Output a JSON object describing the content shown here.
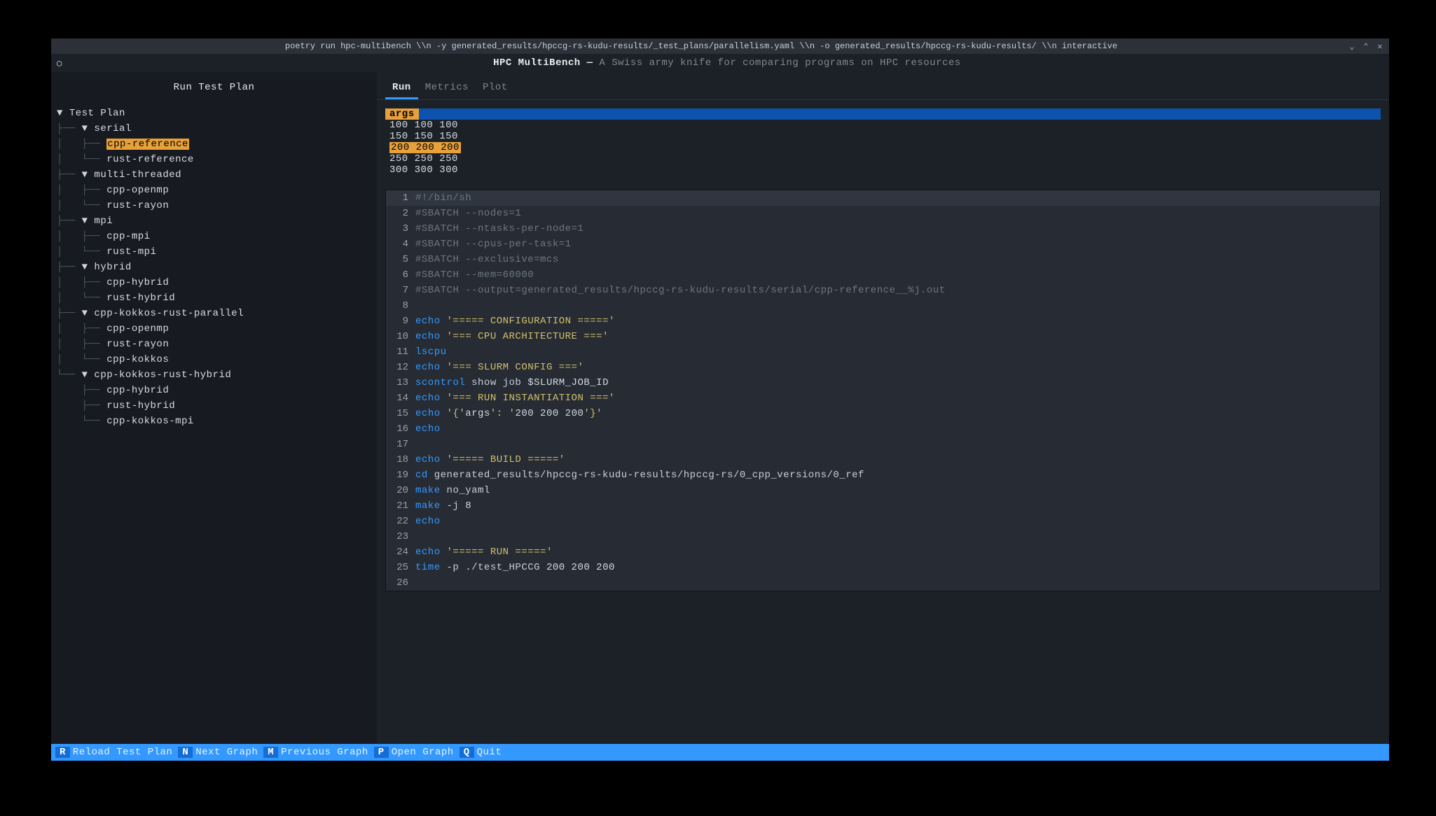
{
  "window": {
    "title": "poetry run hpc-multibench \\\\n -y generated_results/hpccg-rs-kudu-results/_test_plans/parallelism.yaml \\\\n -o generated_results/hpccg-rs-kudu-results/ \\\\n interactive"
  },
  "header": {
    "app_name_bold": "HPC MultiBench —",
    "app_tagline": " A Swiss army knife for comparing programs on HPC resources"
  },
  "sidebar": {
    "title": "Run Test Plan",
    "tree_root": "Test Plan",
    "groups": [
      {
        "name": "serial",
        "items": [
          "cpp-reference",
          "rust-reference"
        ],
        "selected": "cpp-reference"
      },
      {
        "name": "multi-threaded",
        "items": [
          "cpp-openmp",
          "rust-rayon"
        ]
      },
      {
        "name": "mpi",
        "items": [
          "cpp-mpi",
          "rust-mpi"
        ]
      },
      {
        "name": "hybrid",
        "items": [
          "cpp-hybrid",
          "rust-hybrid"
        ]
      },
      {
        "name": "cpp-kokkos-rust-parallel",
        "items": [
          "cpp-openmp",
          "rust-rayon",
          "cpp-kokkos"
        ]
      },
      {
        "name": "cpp-kokkos-rust-hybrid",
        "items": [
          "cpp-hybrid",
          "rust-hybrid",
          "cpp-kokkos-mpi"
        ]
      }
    ]
  },
  "tabs": {
    "items": [
      "Run",
      "Metrics",
      "Plot"
    ],
    "active": "Run"
  },
  "args_panel": {
    "header": "args",
    "rows": [
      "100 100 100",
      "150 150 150",
      "200 200 200",
      "250 250 250",
      "300 300 300"
    ],
    "selected": "200 200 200"
  },
  "code": {
    "lines": [
      {
        "n": 1,
        "kind": "cmt",
        "text": "#!/bin/sh"
      },
      {
        "n": 2,
        "kind": "cmt",
        "text": "#SBATCH --nodes=1"
      },
      {
        "n": 3,
        "kind": "cmt",
        "text": "#SBATCH --ntasks-per-node=1"
      },
      {
        "n": 4,
        "kind": "cmt",
        "text": "#SBATCH --cpus-per-task=1"
      },
      {
        "n": 5,
        "kind": "cmt",
        "text": "#SBATCH --exclusive=mcs"
      },
      {
        "n": 6,
        "kind": "cmt",
        "text": "#SBATCH --mem=60000"
      },
      {
        "n": 7,
        "kind": "cmt",
        "text": "#SBATCH --output=generated_results/hpccg-rs-kudu-results/serial/cpp-reference__%j.out"
      },
      {
        "n": 8,
        "kind": "blank",
        "text": ""
      },
      {
        "n": 9,
        "kind": "echo",
        "cmd": "echo",
        "str": "'===== CONFIGURATION ====='"
      },
      {
        "n": 10,
        "kind": "echo",
        "cmd": "echo",
        "str": "'=== CPU ARCHITECTURE ==='"
      },
      {
        "n": 11,
        "kind": "bare",
        "cmd": "lscpu"
      },
      {
        "n": 12,
        "kind": "echo",
        "cmd": "echo",
        "str": "'=== SLURM CONFIG ==='"
      },
      {
        "n": 13,
        "kind": "cmd3",
        "cmd": "scontrol",
        "arg1": "show job",
        "arg2": "$SLURM_JOB_ID"
      },
      {
        "n": 14,
        "kind": "echo",
        "cmd": "echo",
        "str": "'=== RUN INSTANTIATION ==='"
      },
      {
        "n": 15,
        "kind": "echomix",
        "cmd": "echo",
        "a": "'{'",
        "b": "args",
        "c": "': '",
        "d": "200 200 200",
        "e": "'}'"
      },
      {
        "n": 16,
        "kind": "bare",
        "cmd": "echo"
      },
      {
        "n": 17,
        "kind": "blank",
        "text": ""
      },
      {
        "n": 18,
        "kind": "echo",
        "cmd": "echo",
        "str": "'===== BUILD ====='"
      },
      {
        "n": 19,
        "kind": "cmd2",
        "cmd": "cd",
        "arg": "generated_results/hpccg-rs-kudu-results/hpccg-rs/0_cpp_versions/0_ref"
      },
      {
        "n": 20,
        "kind": "cmd2",
        "cmd": "make",
        "arg": "no_yaml"
      },
      {
        "n": 21,
        "kind": "cmd3b",
        "cmd": "make",
        "arg1": "-j",
        "arg2": "8"
      },
      {
        "n": 22,
        "kind": "bare",
        "cmd": "echo"
      },
      {
        "n": 23,
        "kind": "blank",
        "text": ""
      },
      {
        "n": 24,
        "kind": "echo",
        "cmd": "echo",
        "str": "'===== RUN ====='"
      },
      {
        "n": 25,
        "kind": "cmd3b",
        "cmd": "time",
        "arg1": "-p ./test_HPCCG",
        "arg2": "200 200 200"
      },
      {
        "n": 26,
        "kind": "blank",
        "text": ""
      }
    ]
  },
  "statusbar": {
    "items": [
      {
        "key": "R",
        "label": "Reload Test Plan"
      },
      {
        "key": "N",
        "label": "Next Graph"
      },
      {
        "key": "M",
        "label": "Previous Graph"
      },
      {
        "key": "P",
        "label": "Open Graph"
      },
      {
        "key": "Q",
        "label": "Quit"
      }
    ]
  }
}
